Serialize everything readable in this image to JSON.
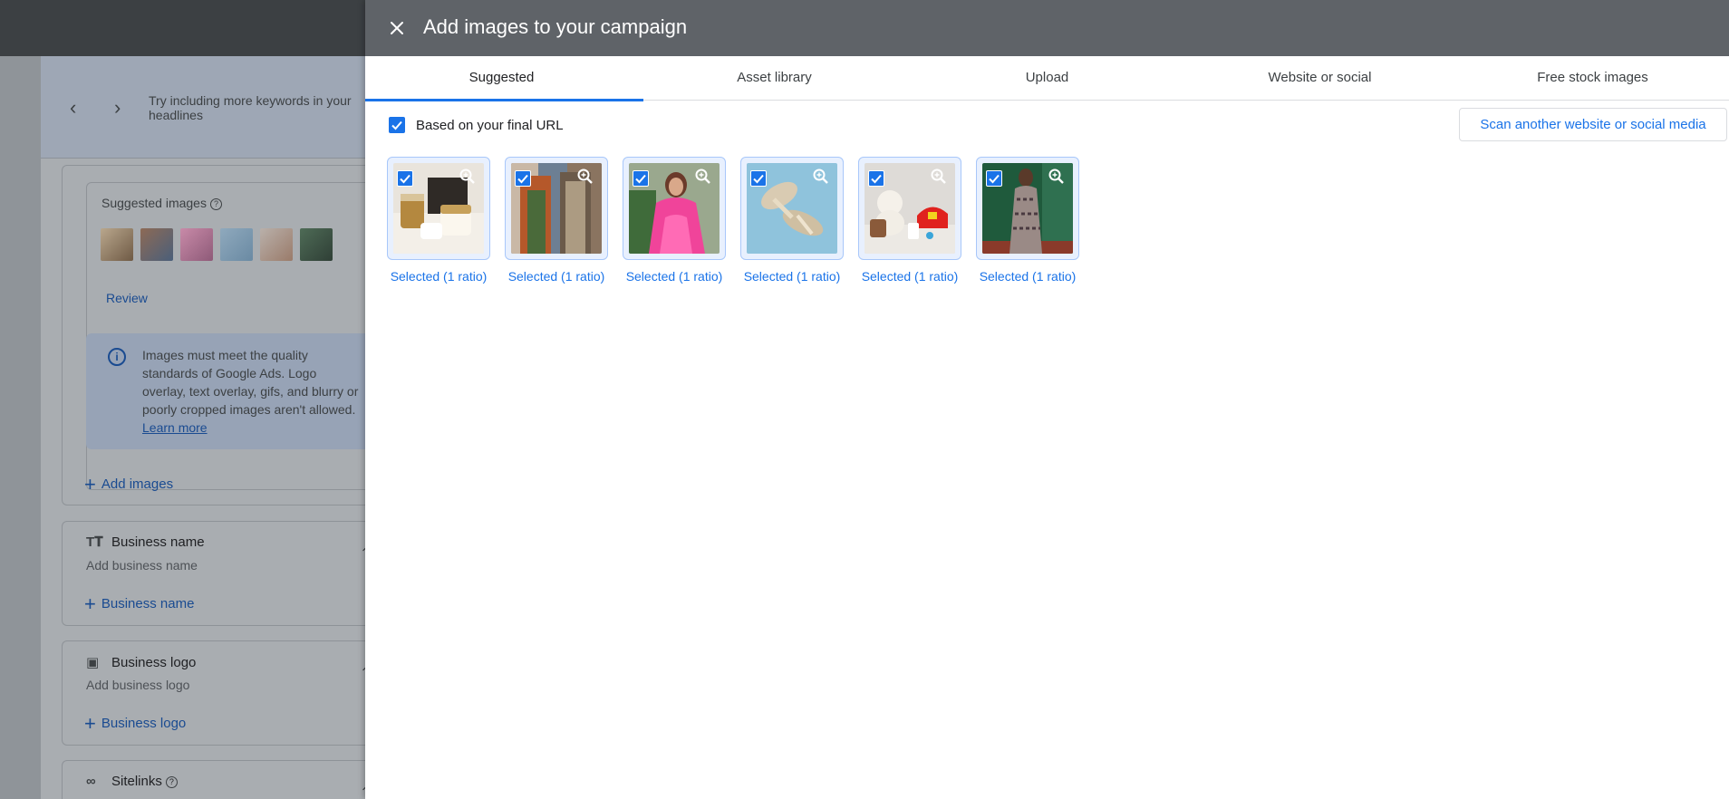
{
  "background_page": {
    "hint": {
      "text": "Try including more keywords in your headlines"
    },
    "suggested_images": {
      "title": "Suggested images",
      "review_label": "Review"
    },
    "info": {
      "text": "Images must meet the quality standards of Google Ads. Logo overlay, text overlay, gifs, and blurry or poorly cropped images aren't allowed.",
      "learn_more": "Learn more"
    },
    "add_images_label": "Add images",
    "business_name": {
      "title": "Business name",
      "placeholder": "Add business name",
      "add_label": "Business name"
    },
    "business_logo": {
      "title": "Business logo",
      "placeholder": "Add business logo",
      "add_label": "Business logo"
    },
    "sitelinks": {
      "title": "Sitelinks"
    }
  },
  "dialog": {
    "title": "Add images to your campaign",
    "tabs": [
      {
        "label": "Suggested",
        "active": true
      },
      {
        "label": "Asset library",
        "active": false
      },
      {
        "label": "Upload",
        "active": false
      },
      {
        "label": "Website or social",
        "active": false
      },
      {
        "label": "Free stock images",
        "active": false
      }
    ],
    "final_url_checkbox": {
      "label": "Based on your final URL",
      "checked": true
    },
    "scan_button_label": "Scan another website or social media",
    "images": [
      {
        "label": "Selected (1 ratio)",
        "checked": true,
        "icon": "skincare-jars-photo"
      },
      {
        "label": "Selected (1 ratio)",
        "checked": true,
        "icon": "outfit-photo"
      },
      {
        "label": "Selected (1 ratio)",
        "checked": true,
        "icon": "pink-dress-photo"
      },
      {
        "label": "Selected (1 ratio)",
        "checked": true,
        "icon": "sandals-photo"
      },
      {
        "label": "Selected (1 ratio)",
        "checked": true,
        "icon": "toys-cap-photo"
      },
      {
        "label": "Selected (1 ratio)",
        "checked": true,
        "icon": "patterned-dress-photo"
      }
    ]
  },
  "colors": {
    "accent": "#1a73e8",
    "header": "#5f6368"
  }
}
